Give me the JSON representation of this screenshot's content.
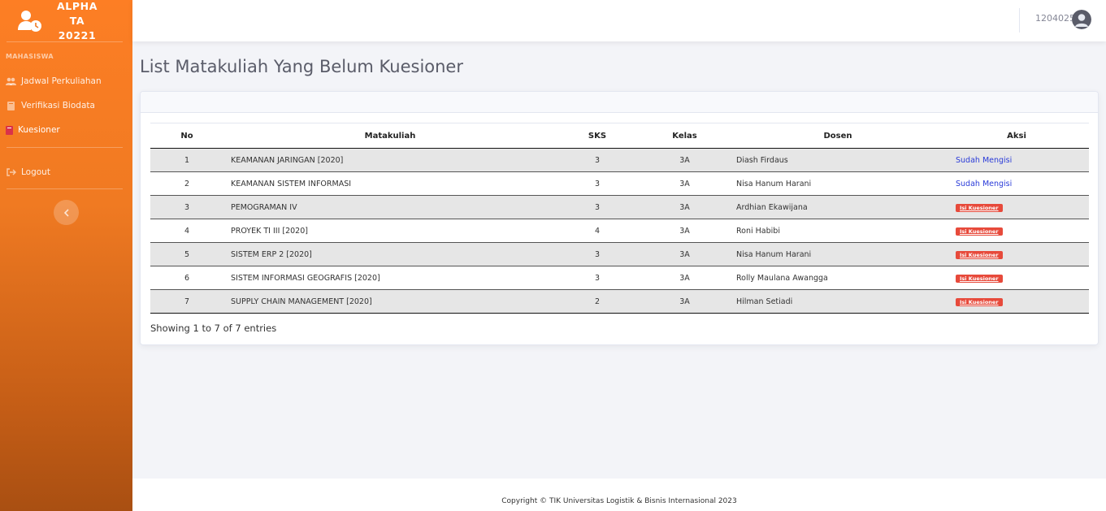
{
  "sidebar": {
    "brand_line1": "ALPHA",
    "brand_line2": "TA 20221",
    "heading": "MAHASISWA",
    "items": [
      {
        "label": "Jadwal Perkuliahan",
        "icon": "users-icon"
      },
      {
        "label": "Verifikasi Biodata",
        "icon": "book-icon"
      },
      {
        "label": "Kuesioner",
        "icon": "book-icon"
      }
    ],
    "logout_label": "Logout"
  },
  "topbar": {
    "user_id": "1204025"
  },
  "page": {
    "title": "List Matakuliah Yang Belum Kuesioner"
  },
  "table": {
    "headers": [
      "No",
      "Matakuliah",
      "SKS",
      "Kelas",
      "Dosen",
      "Aksi"
    ],
    "rows": [
      {
        "no": "1",
        "matakuliah": "KEAMANAN JARINGAN [2020]",
        "sks": "3",
        "kelas": "3A",
        "dosen": "Diash Firdaus",
        "aksi": "Sudah Mengisi"
      },
      {
        "no": "2",
        "matakuliah": "KEAMANAN SISTEM INFORMASI",
        "sks": "3",
        "kelas": "3A",
        "dosen": "Nisa Hanum Harani",
        "aksi": "Sudah Mengisi"
      },
      {
        "no": "3",
        "matakuliah": "PEMOGRAMAN IV",
        "sks": "3",
        "kelas": "3A",
        "dosen": "Ardhian Ekawijana",
        "aksi": "Isi Kuesioner"
      },
      {
        "no": "4",
        "matakuliah": "PROYEK TI III [2020]",
        "sks": "4",
        "kelas": "3A",
        "dosen": "Roni Habibi",
        "aksi": "Isi Kuesioner"
      },
      {
        "no": "5",
        "matakuliah": "SISTEM ERP 2 [2020]",
        "sks": "3",
        "kelas": "3A",
        "dosen": "Nisa Hanum Harani",
        "aksi": "Isi Kuesioner"
      },
      {
        "no": "6",
        "matakuliah": "SISTEM INFORMASI GEOGRAFIS [2020]",
        "sks": "3",
        "kelas": "3A",
        "dosen": "Rolly Maulana Awangga",
        "aksi": "Isi Kuesioner"
      },
      {
        "no": "7",
        "matakuliah": "SUPPLY CHAIN MANAGEMENT [2020]",
        "sks": "2",
        "kelas": "3A",
        "dosen": "Hilman Setiadi",
        "aksi": "Isi Kuesioner"
      }
    ],
    "info": "Showing 1 to 7 of 7 entries"
  },
  "footer": {
    "copyright": "Copyright © TIK Universitas Logistik & Bisnis Internasional 2023"
  },
  "colors": {
    "sidebar_top": "#fd7e24",
    "sidebar_bottom": "#a94f12",
    "danger": "#e74a3b",
    "link": "#2a3bd8"
  }
}
